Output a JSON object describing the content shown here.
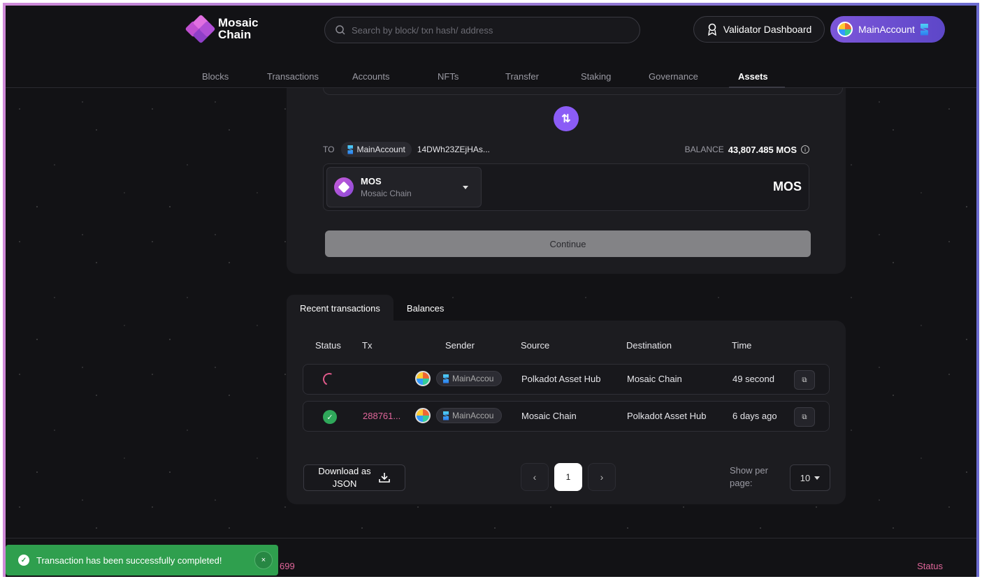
{
  "header": {
    "logo_line1": "Mosaic",
    "logo_line2": "Chain",
    "search_placeholder": "Search by block/ txn hash/ address",
    "validator_label": "Validator Dashboard",
    "account_label": "MainAccount"
  },
  "nav": {
    "items": [
      "Blocks",
      "Transactions",
      "Accounts",
      "NFTs",
      "Transfer",
      "Staking",
      "Governance",
      "Assets"
    ],
    "active": "Assets"
  },
  "transfer": {
    "swap_glyph": "⇅",
    "to_label": "TO",
    "to_account": "MainAccount",
    "to_address": "14DWh23ZEjHAs...",
    "balance_label": "BALANCE",
    "balance_value": "43,807.485 MOS",
    "token_symbol": "MOS",
    "token_chain": "Mosaic Chain",
    "amount_unit": "MOS",
    "continue_label": "Continue"
  },
  "transactions": {
    "tabs": [
      "Recent transactions",
      "Balances"
    ],
    "columns": [
      "Status",
      "Tx",
      "Sender",
      "Source",
      "Destination",
      "Time"
    ],
    "rows": [
      {
        "status": "pending",
        "tx": "",
        "sender": "MainAccou",
        "source": "Polkadot Asset Hub",
        "destination": "Mosaic Chain",
        "time": "49 second"
      },
      {
        "status": "success",
        "tx": "288761...",
        "sender": "MainAccou",
        "source": "Mosaic Chain",
        "destination": "Polkadot Asset Hub",
        "time": "6 days ago"
      }
    ],
    "download_label_1": "Download as",
    "download_label_2": "JSON",
    "page_prev": "‹",
    "page_current": "1",
    "page_next": "›",
    "per_page_label_1": "Show per",
    "per_page_label_2": "page:",
    "per_page_value": "10"
  },
  "footer": {
    "number": "699",
    "status_link": "Status"
  },
  "toast": {
    "message": "Transaction has been successfully completed!",
    "close_glyph": "×"
  },
  "colors": {
    "accent": "#8b5cf6",
    "link_pink": "#e0669a",
    "success": "#2f9f4e"
  }
}
